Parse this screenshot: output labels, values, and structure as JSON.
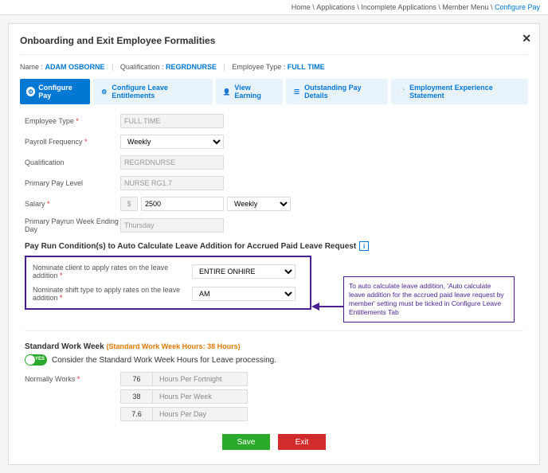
{
  "breadcrumb": [
    "Home",
    "Applications",
    "Incomplete Applications",
    "Member Menu",
    "Configure Pay"
  ],
  "modal_title": "Onboarding and Exit Employee Formalities",
  "summary": {
    "name_label": "Name :",
    "name_value": "ADAM OSBORNE",
    "qual_label": "Qualification :",
    "qual_value": "REGRDNURSE",
    "type_label": "Employee Type :",
    "type_value": "FULL TIME"
  },
  "tabs": {
    "configure_pay": "Configure Pay",
    "configure_leave": "Configure Leave Entitlements",
    "view_earning": "View Earning",
    "outstanding": "Outstanding Pay Details",
    "employment_stmt": "Employment Experience Statement"
  },
  "fields": {
    "employee_type": {
      "label": "Employee Type",
      "value": "FULL TIME"
    },
    "payroll_freq": {
      "label": "Payroll Frequency",
      "value": "Weekly"
    },
    "qualification": {
      "label": "Qualification",
      "value": "REGRDNURSE"
    },
    "pay_level": {
      "label": "Primary Pay Level",
      "value": "NURSE RG1.7"
    },
    "salary": {
      "label": "Salary",
      "currency": "$",
      "amount": "2500",
      "period": "Weekly"
    },
    "week_ending": {
      "label": "Primary Payrun Week Ending Day",
      "value": "Thursday"
    }
  },
  "payrun": {
    "title": "Pay Run Condition(s) to Auto Calculate Leave Addition for Accrued Paid Leave Request",
    "client_label": "Nominate client to apply rates on the leave addition",
    "client_value": "ENTIRE ONHIRE",
    "shift_label": "Nominate shift type to apply rates on the leave addition",
    "shift_value": "AM"
  },
  "callout_text": "To auto calculate leave addition, 'Auto calculate leave addition for the accrued paid leave request by member' setting must be ticked in Configure Leave Entitlements Tab",
  "std_week": {
    "title": "Standard Work Week",
    "note": "(Standard Work Week Hours: 38 Hours)",
    "toggle_state": "YES",
    "toggle_label": "Consider the Standard Work Week Hours for Leave processing.",
    "normally_label": "Normally Works",
    "rows": [
      {
        "value": "76",
        "unit": "Hours Per Fortnight"
      },
      {
        "value": "38",
        "unit": "Hours Per Week"
      },
      {
        "value": "7.6",
        "unit": "Hours Per Day"
      }
    ]
  },
  "buttons": {
    "save": "Save",
    "exit": "Exit"
  }
}
